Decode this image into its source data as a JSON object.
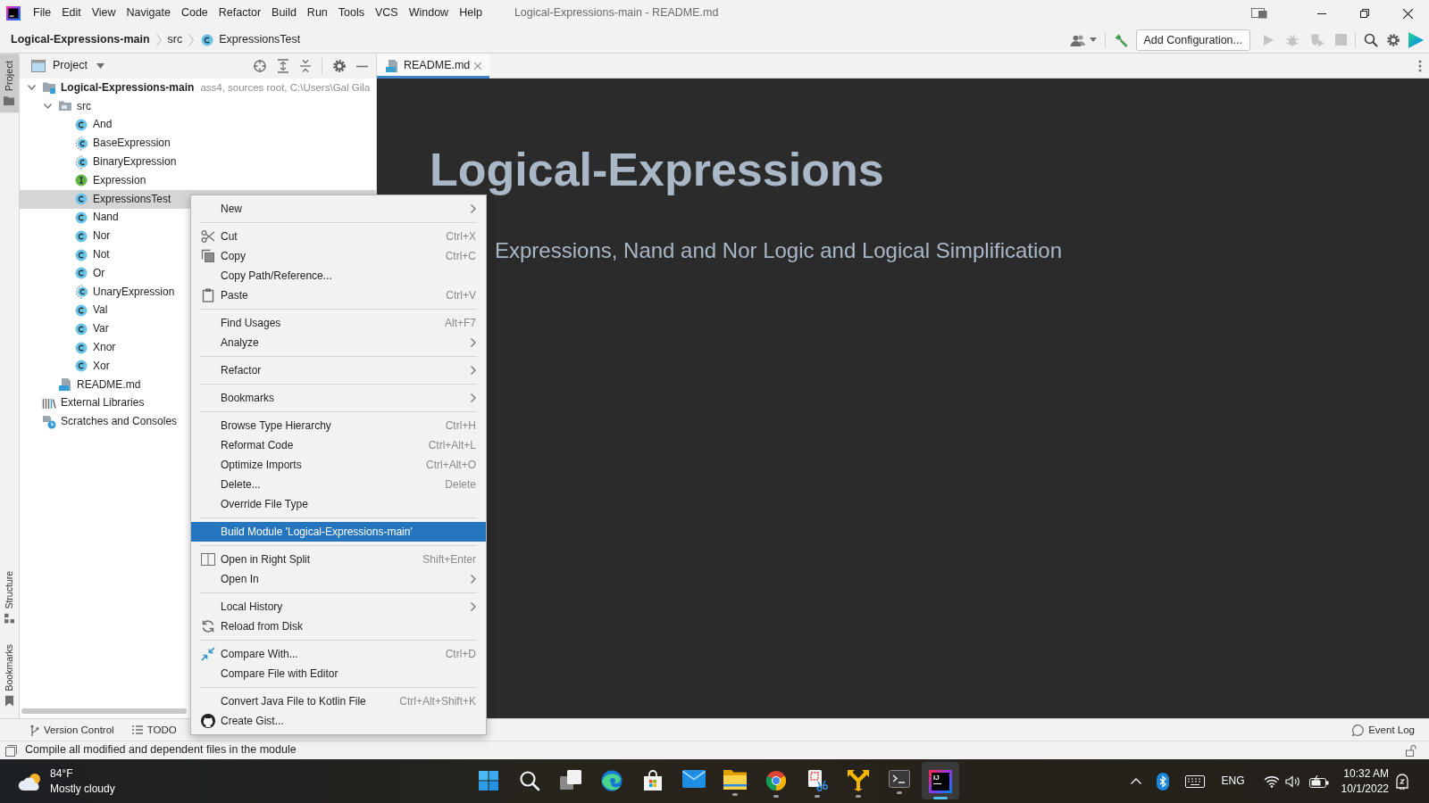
{
  "title_bar": {
    "menu": [
      {
        "label": "File"
      },
      {
        "label": "Edit"
      },
      {
        "label": "View"
      },
      {
        "label": "Navigate"
      },
      {
        "label": "Code"
      },
      {
        "label": "Refactor"
      },
      {
        "label": "Build"
      },
      {
        "label": "Run"
      },
      {
        "label": "Tools"
      },
      {
        "label": "VCS"
      },
      {
        "label": "Window"
      },
      {
        "label": "Help"
      }
    ],
    "title": "Logical-Expressions-main - README.md"
  },
  "navigation_bar": {
    "breadcrumbs": [
      {
        "label": "Logical-Expressions-main",
        "kind": "module"
      },
      {
        "label": "src",
        "kind": "folder"
      },
      {
        "label": "ExpressionsTest",
        "kind": "class"
      }
    ],
    "run_configuration": "Add Configuration...",
    "run_actions": [
      {
        "kind": "run",
        "disabled": true
      },
      {
        "kind": "debug",
        "disabled": true
      },
      {
        "kind": "coverage",
        "disabled": true
      },
      {
        "kind": "stop",
        "disabled": true
      }
    ]
  },
  "tool_window_bar": {
    "top": [
      {
        "label": "Project",
        "kind": "folder",
        "selected": true
      }
    ],
    "bottom": [
      {
        "label": "Structure",
        "kind": "structure",
        "selected": false
      },
      {
        "label": "Bookmarks",
        "kind": "bookmark",
        "selected": false
      }
    ]
  },
  "project_panel": {
    "title": "Project",
    "tree": [
      {
        "label": "Logical-Expressions-main",
        "kind": "module",
        "detail": "ass4, sources root, C:\\Users\\Gal Gila",
        "expanded": true,
        "selected": false,
        "children": [
          {
            "label": "src",
            "kind": "folder",
            "expanded": true,
            "selected": false,
            "children": [
              {
                "label": "And",
                "kind": "class",
                "selected": false
              },
              {
                "label": "BaseExpression",
                "kind": "abstract",
                "selected": false
              },
              {
                "label": "BinaryExpression",
                "kind": "abstract",
                "selected": false
              },
              {
                "label": "Expression",
                "kind": "interface",
                "selected": false
              },
              {
                "label": "ExpressionsTest",
                "kind": "class",
                "selected": true
              },
              {
                "label": "Nand",
                "kind": "class",
                "selected": false
              },
              {
                "label": "Nor",
                "kind": "class",
                "selected": false
              },
              {
                "label": "Not",
                "kind": "class",
                "selected": false
              },
              {
                "label": "Or",
                "kind": "class",
                "selected": false
              },
              {
                "label": "UnaryExpression",
                "kind": "abstract",
                "selected": false
              },
              {
                "label": "Val",
                "kind": "class",
                "selected": false
              },
              {
                "label": "Var",
                "kind": "class",
                "selected": false
              },
              {
                "label": "Xnor",
                "kind": "class",
                "selected": false
              },
              {
                "label": "Xor",
                "kind": "class",
                "selected": false
              }
            ]
          },
          {
            "label": "README.md",
            "kind": "markdown",
            "selected": false
          }
        ]
      },
      {
        "label": "External Libraries",
        "kind": "libraries",
        "selected": false
      },
      {
        "label": "Scratches and Consoles",
        "kind": "scratches",
        "selected": false
      }
    ]
  },
  "editor": {
    "tabs": [
      {
        "label": "README.md",
        "kind": "markdown",
        "selected": true
      }
    ],
    "heading": "Logical-Expressions",
    "subtitle": "Expressions, Nand and Nor Logic and Logical Simplification"
  },
  "context_menu": {
    "groups": [
      [
        {
          "label": "New",
          "kind": "plain",
          "submenu": true,
          "selected": false
        }
      ],
      [
        {
          "label": "Cut",
          "kind": "cut",
          "shortcut": "Ctrl+X",
          "submenu": false,
          "selected": false
        },
        {
          "label": "Copy",
          "kind": "copy",
          "shortcut": "Ctrl+C",
          "submenu": false,
          "selected": false
        },
        {
          "label": "Copy Path/Reference...",
          "kind": "plain",
          "submenu": false,
          "selected": false
        },
        {
          "label": "Paste",
          "kind": "paste",
          "shortcut": "Ctrl+V",
          "submenu": false,
          "selected": false
        }
      ],
      [
        {
          "label": "Find Usages",
          "kind": "plain",
          "shortcut": "Alt+F7",
          "submenu": false,
          "selected": false
        },
        {
          "label": "Analyze",
          "kind": "plain",
          "submenu": true,
          "selected": false
        }
      ],
      [
        {
          "label": "Refactor",
          "kind": "plain",
          "submenu": true,
          "selected": false
        }
      ],
      [
        {
          "label": "Bookmarks",
          "kind": "plain",
          "submenu": true,
          "selected": false
        }
      ],
      [
        {
          "label": "Browse Type Hierarchy",
          "kind": "plain",
          "shortcut": "Ctrl+H",
          "submenu": false,
          "selected": false
        },
        {
          "label": "Reformat Code",
          "kind": "plain",
          "shortcut": "Ctrl+Alt+L",
          "submenu": false,
          "selected": false
        },
        {
          "label": "Optimize Imports",
          "kind": "plain",
          "shortcut": "Ctrl+Alt+O",
          "submenu": false,
          "selected": false
        },
        {
          "label": "Delete...",
          "kind": "plain",
          "shortcut": "Delete",
          "submenu": false,
          "selected": false
        },
        {
          "label": "Override File Type",
          "kind": "plain",
          "submenu": false,
          "selected": false
        }
      ],
      [
        {
          "label": "Build Module 'Logical-Expressions-main'",
          "kind": "plain",
          "submenu": false,
          "selected": true
        }
      ],
      [
        {
          "label": "Open in Right Split",
          "kind": "split",
          "shortcut": "Shift+Enter",
          "submenu": false,
          "selected": false
        },
        {
          "label": "Open In",
          "kind": "plain",
          "submenu": true,
          "selected": false
        }
      ],
      [
        {
          "label": "Local History",
          "kind": "plain",
          "submenu": true,
          "selected": false
        },
        {
          "label": "Reload from Disk",
          "kind": "reload",
          "submenu": false,
          "selected": false
        }
      ],
      [
        {
          "label": "Compare With...",
          "kind": "compare",
          "shortcut": "Ctrl+D",
          "submenu": false,
          "selected": false
        },
        {
          "label": "Compare File with Editor",
          "kind": "plain",
          "submenu": false,
          "selected": false
        }
      ],
      [
        {
          "label": "Convert Java File to Kotlin File",
          "kind": "plain",
          "shortcut": "Ctrl+Alt+Shift+K",
          "submenu": false,
          "selected": false
        },
        {
          "label": "Create Gist...",
          "kind": "gist",
          "submenu": false,
          "selected": false
        }
      ]
    ]
  },
  "bottom_bar": {
    "tabs": [
      {
        "label": "Version Control",
        "kind": "branch"
      },
      {
        "label": "TODO",
        "kind": "list"
      }
    ],
    "event_log": "Event Log"
  },
  "status_bar": {
    "message": "Compile all modified and dependent files in the module"
  },
  "taskbar": {
    "weather": {
      "temperature": "84°F",
      "condition": "Mostly cloudy"
    },
    "apps": [
      {
        "kind": "start",
        "running": false,
        "selected": false
      },
      {
        "kind": "search",
        "running": false,
        "selected": false
      },
      {
        "kind": "taskview",
        "running": false,
        "selected": false
      },
      {
        "kind": "swirl",
        "running": false,
        "selected": false
      },
      {
        "kind": "store",
        "running": false,
        "selected": false
      },
      {
        "kind": "mail",
        "running": false,
        "selected": false
      },
      {
        "kind": "folder",
        "running": true,
        "selected": false
      },
      {
        "kind": "orb",
        "running": true,
        "selected": false
      },
      {
        "kind": "snip",
        "running": true,
        "selected": false
      },
      {
        "kind": "arrows",
        "running": true,
        "selected": false
      },
      {
        "kind": "terminal",
        "running": true,
        "selected": false
      },
      {
        "kind": "ide",
        "label": "IJ",
        "running": true,
        "selected": true
      }
    ],
    "tray": {
      "language": "ENG",
      "time": "10:32 AM",
      "date": "10/1/2022"
    }
  }
}
